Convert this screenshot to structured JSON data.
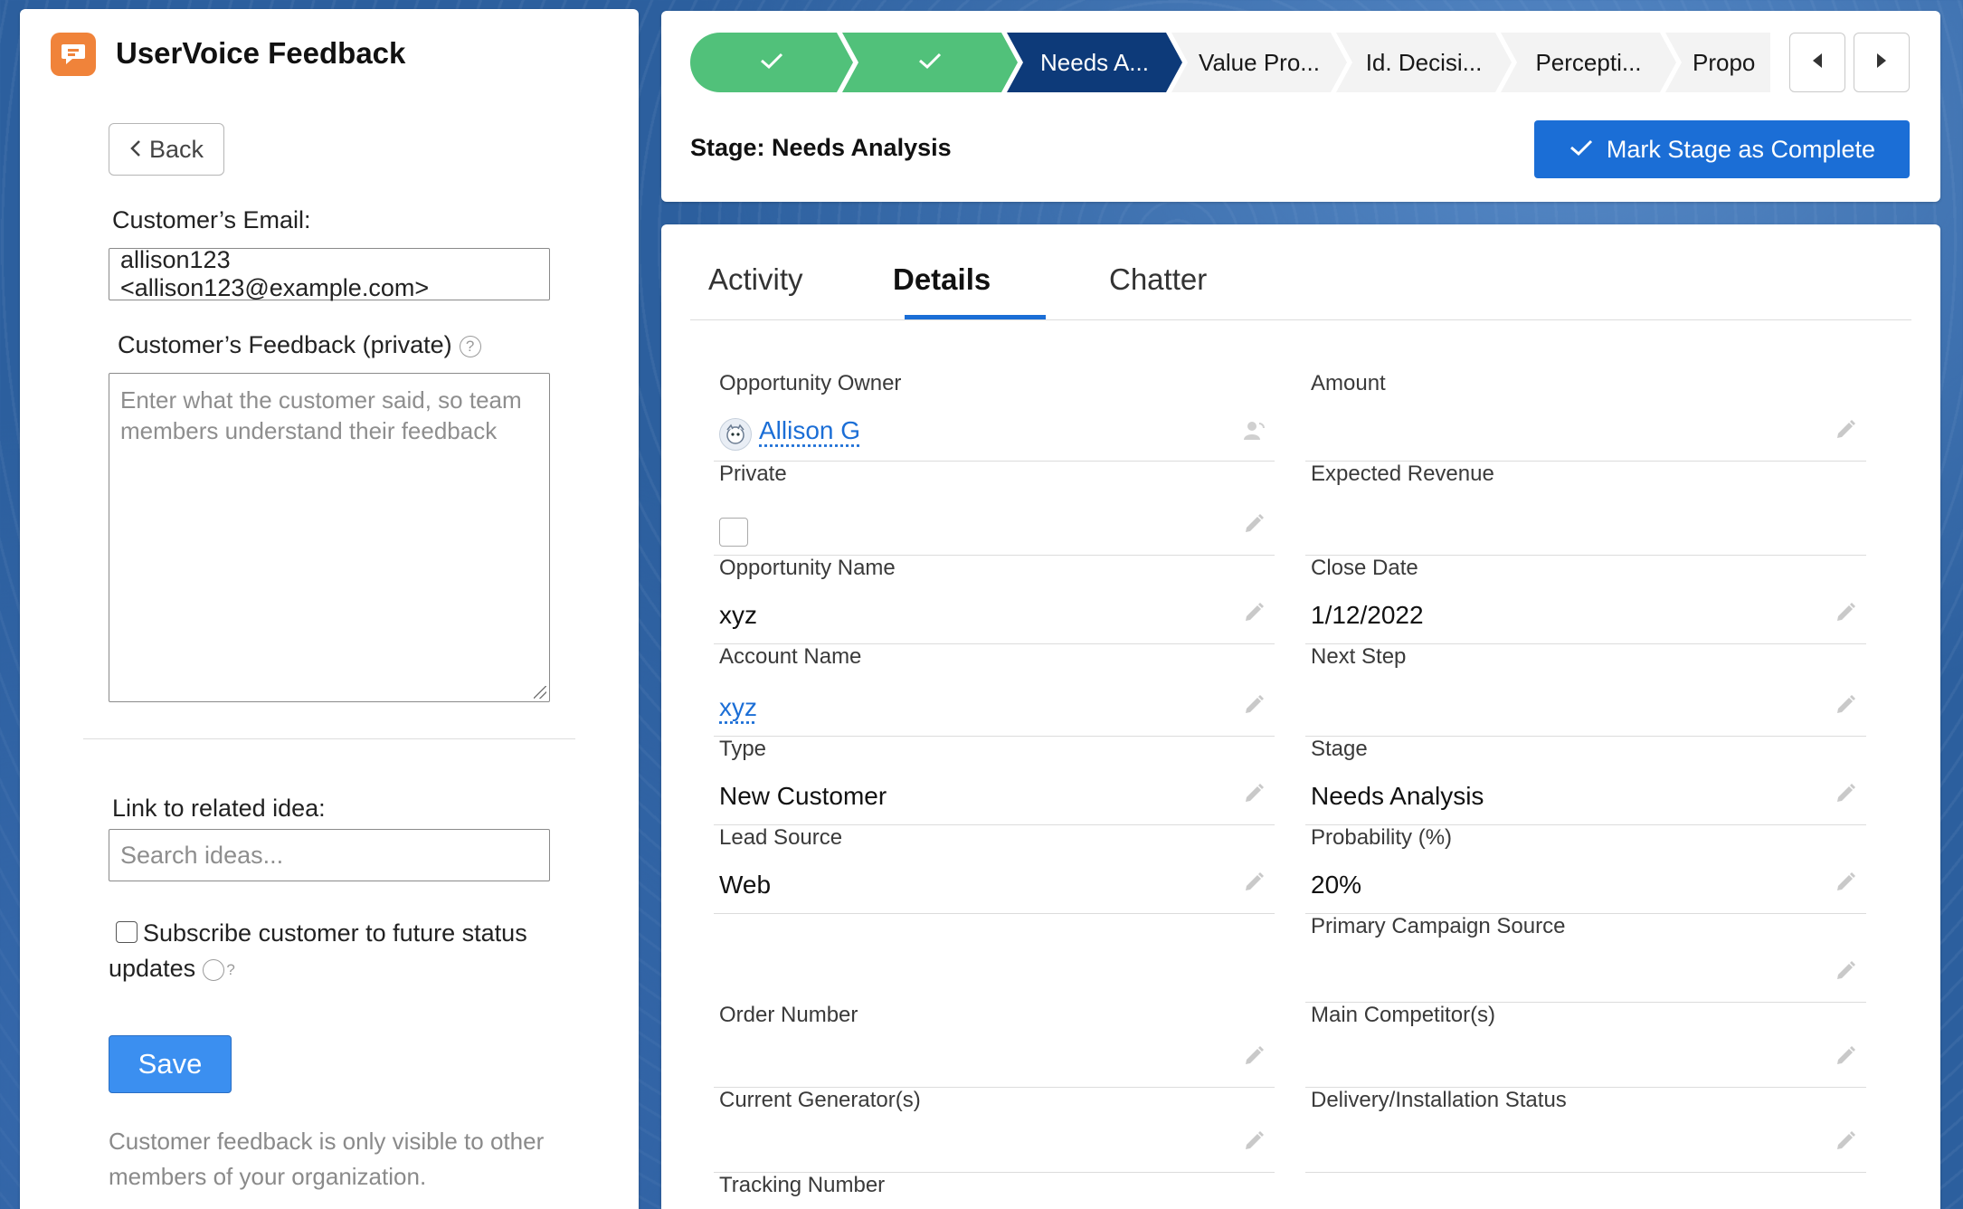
{
  "left_panel": {
    "app_title": "UserVoice Feedback",
    "back_label": "Back",
    "email_label": "Customer’s Email:",
    "email_value": "allison123 <allison123@example.com>",
    "feedback_label": "Customer’s Feedback (private)",
    "feedback_placeholder": "Enter what the customer said, so team members understand their feedback",
    "link_idea_label": "Link to related idea:",
    "search_placeholder": "Search ideas...",
    "subscribe_label": "Subscribe customer to future status updates",
    "save_label": "Save",
    "footnote": "Customer feedback is only visible to other members of your organization."
  },
  "path": {
    "steps": [
      {
        "label": "✓",
        "state": "done"
      },
      {
        "label": "✓",
        "state": "done"
      },
      {
        "label": "Needs A...",
        "state": "current"
      },
      {
        "label": "Value Pro...",
        "state": "future"
      },
      {
        "label": "Id. Decisi...",
        "state": "future"
      },
      {
        "label": "Percepti...",
        "state": "future"
      },
      {
        "label": "Propo",
        "state": "future"
      }
    ],
    "stage_text": "Stage: Needs Analysis",
    "mark_button": "Mark Stage as Complete"
  },
  "tabs": [
    {
      "label": "Activity",
      "active": false
    },
    {
      "label": "Details",
      "active": true
    },
    {
      "label": "Chatter",
      "active": false
    }
  ],
  "details": {
    "left": [
      {
        "label": "Opportunity Owner",
        "value": "Allison G",
        "kind": "owner"
      },
      {
        "label": "Private",
        "value": "",
        "kind": "checkbox"
      },
      {
        "label": "Opportunity Name",
        "value": "xyz",
        "kind": "text"
      },
      {
        "label": "Account Name",
        "value": "xyz",
        "kind": "link"
      },
      {
        "label": "Type",
        "value": "New Customer",
        "kind": "text"
      },
      {
        "label": "Lead Source",
        "value": "Web",
        "kind": "text"
      },
      {
        "label": "",
        "value": "",
        "kind": "blank"
      },
      {
        "label": "Order Number",
        "value": "",
        "kind": "text"
      },
      {
        "label": "Current Generator(s)",
        "value": "",
        "kind": "text"
      },
      {
        "label": "Tracking Number",
        "value": "",
        "kind": "text"
      }
    ],
    "right": [
      {
        "label": "Amount",
        "value": "",
        "kind": "text"
      },
      {
        "label": "Expected Revenue",
        "value": "",
        "kind": "readonly"
      },
      {
        "label": "Close Date",
        "value": "1/12/2022",
        "kind": "text"
      },
      {
        "label": "Next Step",
        "value": "",
        "kind": "text"
      },
      {
        "label": "Stage",
        "value": "Needs Analysis",
        "kind": "text"
      },
      {
        "label": "Probability (%)",
        "value": "20%",
        "kind": "text"
      },
      {
        "label": "Primary Campaign Source",
        "value": "",
        "kind": "text"
      },
      {
        "label": "Main Competitor(s)",
        "value": "",
        "kind": "text"
      },
      {
        "label": "Delivery/Installation Status",
        "value": "",
        "kind": "text"
      }
    ]
  },
  "colors": {
    "path_done": "#51c17a",
    "path_current": "#0d3a79",
    "brand_button": "#1b6ed6",
    "save_button": "#3b8ff0",
    "logo": "#f0833a"
  }
}
